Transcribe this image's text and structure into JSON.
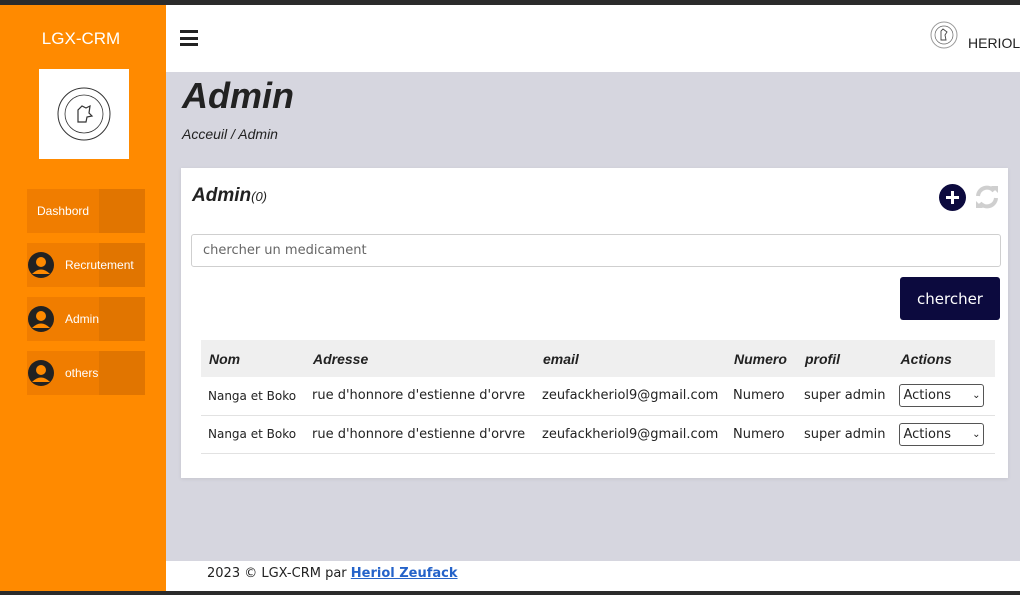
{
  "brand": {
    "name": "LGX-CRM"
  },
  "sidebar": {
    "items": [
      {
        "label": "Dashbord",
        "icon": "none"
      },
      {
        "label": "Recrutement",
        "icon": "user-icon"
      },
      {
        "label": "Admin",
        "icon": "user-icon"
      },
      {
        "label": "others",
        "icon": "user-icon"
      }
    ]
  },
  "topbar": {
    "user_name": "HERIOL"
  },
  "header": {
    "title": "Admin",
    "breadcrumb": "Acceuil / Admin"
  },
  "card": {
    "title": "Admin",
    "count": "(0)",
    "search_placeholder": "chercher un medicament",
    "search_button": "chercher"
  },
  "table": {
    "headers": [
      "Nom",
      "Adresse",
      "email",
      "Numero",
      "profil",
      "Actions"
    ],
    "rows": [
      {
        "nom": "Nanga et Boko",
        "adresse": "rue d'honnore d'estienne d'orvre",
        "email": "zeufackheriol9@gmail.com",
        "numero": "Numero",
        "profil": "super admin",
        "action": "Actions"
      },
      {
        "nom": "Nanga et Boko",
        "adresse": "rue d'honnore d'estienne d'orvre",
        "email": "zeufackheriol9@gmail.com",
        "numero": "Numero",
        "profil": "super admin",
        "action": "Actions"
      }
    ]
  },
  "footer": {
    "text": "2023 © LGX-CRM par",
    "link": "Heriol Zeufack"
  },
  "colors": {
    "sidebar": "#ff8a00",
    "accent": "#0c0a3e",
    "background": "#d6d6df"
  }
}
